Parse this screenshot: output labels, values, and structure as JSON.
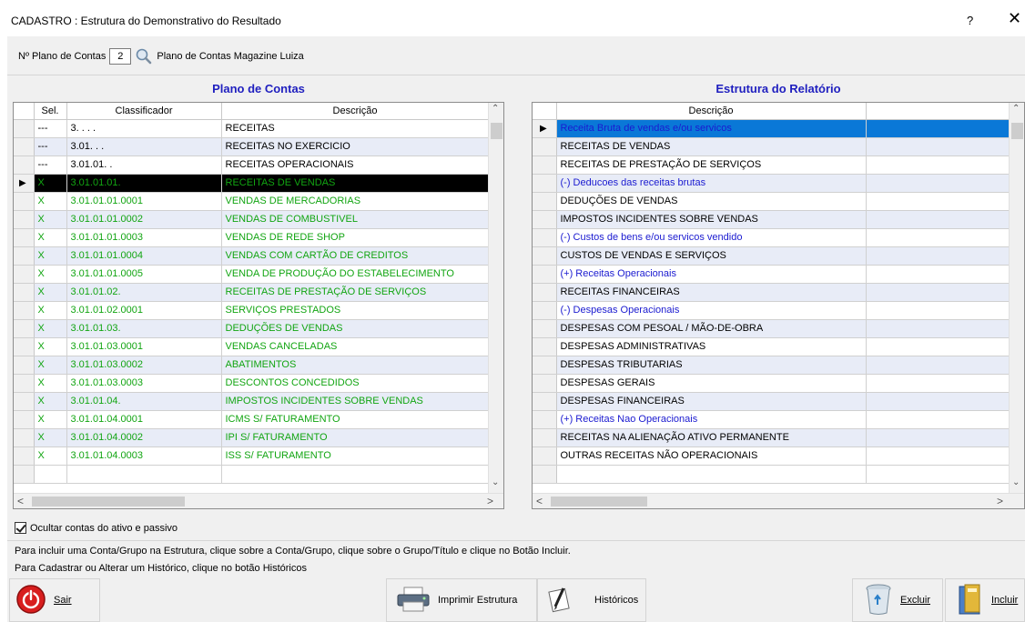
{
  "window": {
    "title": "CADASTRO : Estrutura do Demonstrativo do Resultado",
    "help_label": "?",
    "close_label": "✕"
  },
  "plano": {
    "label": "Nº Plano de Contas",
    "number": "2",
    "name": "Plano de Contas Magazine Luiza"
  },
  "left_panel": {
    "title": "Plano de Contas",
    "columns": [
      "Sel.",
      "Classificador",
      "Descrição"
    ],
    "rows": [
      {
        "sel": "---",
        "class": "3.  .  .  .",
        "desc": "RECEITAS"
      },
      {
        "sel": "---",
        "class": "3.01.  .  .",
        "desc": "RECEITAS NO EXERCICIO"
      },
      {
        "sel": "---",
        "class": "3.01.01.  .",
        "desc": "RECEITAS OPERACIONAIS"
      },
      {
        "sel": "X",
        "class": "3.01.01.01.",
        "desc": "RECEITAS DE VENDAS"
      },
      {
        "sel": "X",
        "class": "3.01.01.01.0001",
        "desc": "VENDAS DE MERCADORIAS"
      },
      {
        "sel": "X",
        "class": "3.01.01.01.0002",
        "desc": "VENDAS DE COMBUSTIVEL"
      },
      {
        "sel": "X",
        "class": "3.01.01.01.0003",
        "desc": "VENDAS DE REDE SHOP"
      },
      {
        "sel": "X",
        "class": "3.01.01.01.0004",
        "desc": "VENDAS COM CARTÃO DE CREDITOS"
      },
      {
        "sel": "X",
        "class": "3.01.01.01.0005",
        "desc": "VENDA DE PRODUÇÃO DO ESTABELECIMENTO"
      },
      {
        "sel": "X",
        "class": "3.01.01.02.",
        "desc": "RECEITAS DE PRESTAÇÃO DE SERVIÇOS"
      },
      {
        "sel": "X",
        "class": "3.01.01.02.0001",
        "desc": "SERVIÇOS PRESTADOS"
      },
      {
        "sel": "X",
        "class": "3.01.01.03.",
        "desc": "DEDUÇÕES DE VENDAS"
      },
      {
        "sel": "X",
        "class": "3.01.01.03.0001",
        "desc": "VENDAS CANCELADAS"
      },
      {
        "sel": "X",
        "class": "3.01.01.03.0002",
        "desc": "ABATIMENTOS"
      },
      {
        "sel": "X",
        "class": "3.01.01.03.0003",
        "desc": "DESCONTOS CONCEDIDOS"
      },
      {
        "sel": "X",
        "class": "3.01.01.04.",
        "desc": "IMPOSTOS INCIDENTES SOBRE VENDAS"
      },
      {
        "sel": "X",
        "class": "3.01.01.04.0001",
        "desc": "ICMS S/ FATURAMENTO"
      },
      {
        "sel": "X",
        "class": "3.01.01.04.0002",
        "desc": "IPI S/ FATURAMENTO"
      },
      {
        "sel": "X",
        "class": "3.01.01.04.0003",
        "desc": "ISS S/ FATURAMENTO"
      }
    ]
  },
  "right_panel": {
    "title": "Estrutura do Relatório",
    "columns": [
      "Descrição"
    ],
    "rows": [
      {
        "desc": "Receita Bruta de vendas e/ou servicos",
        "kind": "title"
      },
      {
        "desc": "RECEITAS DE VENDAS",
        "kind": "item"
      },
      {
        "desc": "RECEITAS DE PRESTAÇÃO DE SERVIÇOS",
        "kind": "item"
      },
      {
        "desc": "(-) Deducoes das receitas brutas",
        "kind": "title"
      },
      {
        "desc": "DEDUÇÕES DE VENDAS",
        "kind": "item"
      },
      {
        "desc": "IMPOSTOS INCIDENTES SOBRE VENDAS",
        "kind": "item"
      },
      {
        "desc": "(-) Custos de bens e/ou servicos vendido",
        "kind": "title"
      },
      {
        "desc": "CUSTOS DE VENDAS E SERVIÇOS",
        "kind": "item"
      },
      {
        "desc": "(+) Receitas Operacionais",
        "kind": "title"
      },
      {
        "desc": "RECEITAS FINANCEIRAS",
        "kind": "item"
      },
      {
        "desc": "(-) Despesas Operacionais",
        "kind": "title"
      },
      {
        "desc": "DESPESAS COM PESOAL / MÃO-DE-OBRA",
        "kind": "item"
      },
      {
        "desc": "DESPESAS ADMINISTRATIVAS",
        "kind": "item"
      },
      {
        "desc": "DESPESAS TRIBUTARIAS",
        "kind": "item"
      },
      {
        "desc": "DESPESAS GERAIS",
        "kind": "item"
      },
      {
        "desc": "DESPESAS FINANCEIRAS",
        "kind": "item"
      },
      {
        "desc": "(+) Receitas Nao Operacionais",
        "kind": "title"
      },
      {
        "desc": "RECEITAS NA ALIENAÇÃO ATIVO PERMANENTE",
        "kind": "item"
      },
      {
        "desc": "OUTRAS RECEITAS NÃO OPERACIONAIS",
        "kind": "item"
      }
    ]
  },
  "options": {
    "hide_assets_label": "Ocultar contas do ativo e passivo",
    "hide_assets_checked": true
  },
  "info": {
    "line1": "Para incluir uma Conta/Grupo na Estrutura, clique sobre a Conta/Grupo, clique sobre o Grupo/Título e clique no Botão Incluir.",
    "line2": "Para Cadastrar ou Alterar um Histórico, clique no botão Históricos"
  },
  "buttons": {
    "sair": "Sair",
    "imprimir": "Imprimir Estrutura",
    "historicos": "Históricos",
    "excluir": "Excluir",
    "incluir": "Incluir"
  },
  "colors": {
    "title_blue": "#1f1fbf",
    "green_text": "#12a512",
    "highlight_blue": "#0a78d7",
    "link_blue": "#1a1ad0"
  }
}
